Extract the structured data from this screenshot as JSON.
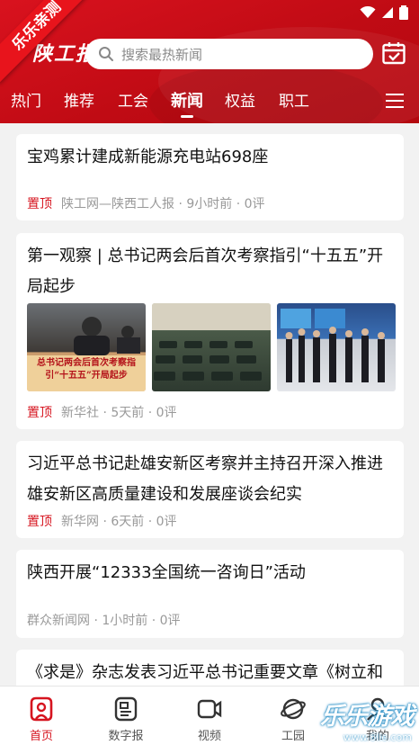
{
  "watermark_ribbon": "乐乐亲测",
  "logo_text": "陕工报",
  "search": {
    "placeholder": "搜索最热新闻"
  },
  "tabs": [
    {
      "label": "热门"
    },
    {
      "label": "推荐"
    },
    {
      "label": "工会"
    },
    {
      "label": "新闻",
      "active": true
    },
    {
      "label": "权益"
    },
    {
      "label": "职工"
    }
  ],
  "articles": [
    {
      "title": "宝鸡累计建成新能源充电站698座",
      "pinned": "置顶",
      "meta": "陕工网—陕西工人报 · 9小时前 · 0评"
    },
    {
      "title": "第一观察 | 总书记两会后首次考察指引“十五五”开局起步",
      "pinned": "置顶",
      "meta": "新华社 · 5天前 · 0评",
      "image_caption": "总书记两会后首次考察指引“十五五”开局起步"
    },
    {
      "title": "习近平总书记赴雄安新区考察并主持召开深入推进雄安新区高质量建设和发展座谈会纪实",
      "pinned": "置顶",
      "meta": "新华网 · 6天前 · 0评"
    },
    {
      "title": "陕西开展“12333全国统一咨询日”活动",
      "pinned": "",
      "meta": "群众新闻网 · 1小时前 · 0评"
    },
    {
      "title": "《求是》杂志发表习近平总书记重要文章《树立和"
    }
  ],
  "bottom_nav": [
    {
      "label": "首页",
      "icon": "home-icon",
      "active": true
    },
    {
      "label": "数字报",
      "icon": "newspaper-icon"
    },
    {
      "label": "视频",
      "icon": "video-icon"
    },
    {
      "label": "工园",
      "icon": "planet-icon"
    },
    {
      "label": "我的",
      "icon": "user-icon"
    }
  ],
  "corner_watermark": {
    "text": "乐乐游戏",
    "url": "www.6lle.com"
  },
  "colors": {
    "brand_red": "#d6141f",
    "header_red": "#c00b14"
  }
}
